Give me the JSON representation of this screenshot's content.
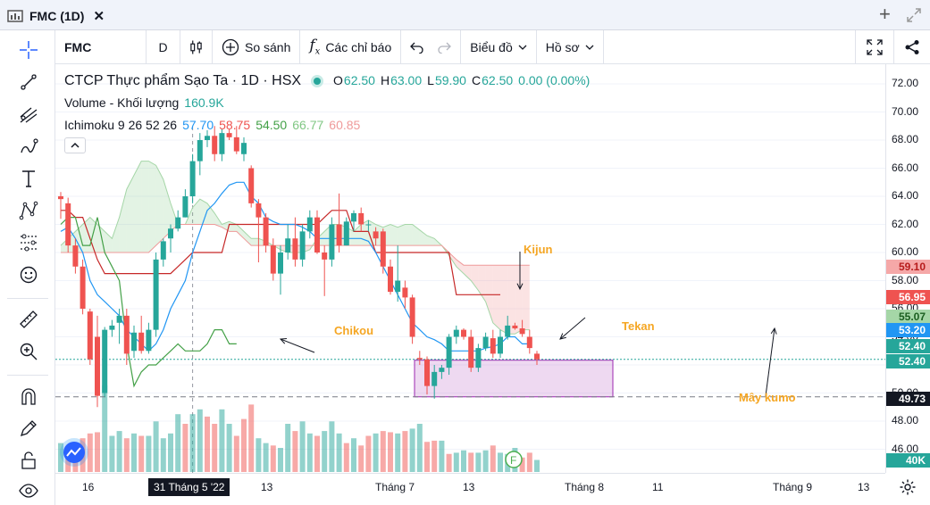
{
  "tab": {
    "title": "FMC (1D)"
  },
  "toolbar": {
    "symbol": "FMC",
    "interval": "D",
    "compare": "So sánh",
    "indicators": "Các chỉ báo",
    "chart_type": "Biểu đồ",
    "profile": "Hồ sơ"
  },
  "legend": {
    "name": "CTCP Thực phẩm Sạo Ta · 1D · HSX",
    "o_key": "O",
    "o": "62.50",
    "h_key": "H",
    "h": "63.00",
    "l_key": "L",
    "l": "59.90",
    "c_key": "C",
    "c": "62.50",
    "change": "0.00 (0.00%)",
    "volume_label": "Volume - Khối lượng",
    "volume_value": "160.9K",
    "ichimoku_label": "Ichimoku 9 26 52 26",
    "ichi_values": [
      "57.70",
      "58.75",
      "54.50",
      "66.77",
      "60.85"
    ],
    "ichi_colors": [
      "#2196f3",
      "#ef5350",
      "#43a047",
      "#81c784",
      "#ef9a9a"
    ]
  },
  "price_axis": {
    "ticks": [
      "72.00",
      "70.00",
      "68.00",
      "66.00",
      "64.00",
      "62.00",
      "60.00",
      "58.00",
      "56.00",
      "54.00",
      "50.00",
      "48.00",
      "46.00"
    ],
    "labels": [
      {
        "text": "59.10",
        "color": "#f5a8a8",
        "text_color": "#b71c1c"
      },
      {
        "text": "56.95",
        "color": "#ef5350",
        "text_color": "#ffffff"
      },
      {
        "text": "55.07",
        "color": "#a5d6a7",
        "text_color": "#1b5e20"
      },
      {
        "text": "53.20",
        "color": "#2196f3",
        "text_color": "#ffffff"
      },
      {
        "text": "52.40",
        "color": "#26a69a",
        "text_color": "#ffffff"
      },
      {
        "text": "52.40",
        "color": "#26a69a",
        "text_color": "#ffffff"
      },
      {
        "text": "49.73",
        "color": "#131722",
        "text_color": "#ffffff"
      },
      {
        "text": "40K",
        "color": "#26a69a",
        "text_color": "#ffffff"
      }
    ]
  },
  "time_axis": {
    "labels": [
      "16",
      "13",
      "Tháng 7",
      "13",
      "Tháng 8",
      "11",
      "Tháng 9",
      "13"
    ],
    "highlight": "31 Tháng 5 '22"
  },
  "annotations": {
    "chikou": "Chikou",
    "kijun": "Kijun",
    "tekan": "Tekan",
    "kumo": "Mây kumo"
  },
  "chart_data": {
    "type": "candlestick",
    "y_range": [
      45.5,
      73
    ],
    "candles": [
      {
        "o": 64.0,
        "h": 64.3,
        "l": 62.4,
        "c": 63.8
      },
      {
        "o": 63.5,
        "h": 63.9,
        "l": 60.0,
        "c": 60.5
      },
      {
        "o": 60.5,
        "h": 61.0,
        "l": 58.5,
        "c": 59.0
      },
      {
        "o": 59.0,
        "h": 59.5,
        "l": 55.6,
        "c": 56.0
      },
      {
        "o": 55.8,
        "h": 56.0,
        "l": 52.0,
        "c": 52.4
      },
      {
        "o": 54.0,
        "h": 55.5,
        "l": 49.0,
        "c": 49.8
      },
      {
        "o": 50.0,
        "h": 54.7,
        "l": 49.7,
        "c": 54.5
      },
      {
        "o": 54.5,
        "h": 55.2,
        "l": 54.0,
        "c": 54.8
      },
      {
        "o": 55.0,
        "h": 56.0,
        "l": 53.5,
        "c": 55.5
      },
      {
        "o": 55.5,
        "h": 56.0,
        "l": 52.0,
        "c": 52.8
      },
      {
        "o": 53.0,
        "h": 54.8,
        "l": 52.5,
        "c": 54.3
      },
      {
        "o": 54.3,
        "h": 55.5,
        "l": 52.8,
        "c": 53.0
      },
      {
        "o": 53.0,
        "h": 55.0,
        "l": 52.8,
        "c": 54.5
      },
      {
        "o": 54.5,
        "h": 60.0,
        "l": 54.0,
        "c": 59.5
      },
      {
        "o": 59.5,
        "h": 61.0,
        "l": 59.0,
        "c": 60.8
      },
      {
        "o": 61.0,
        "h": 62.0,
        "l": 60.0,
        "c": 61.7
      },
      {
        "o": 61.7,
        "h": 63.0,
        "l": 61.5,
        "c": 62.5
      },
      {
        "o": 62.5,
        "h": 64.5,
        "l": 62.5,
        "c": 64.0
      },
      {
        "o": 64.0,
        "h": 67.0,
        "l": 63.5,
        "c": 66.5
      },
      {
        "o": 66.5,
        "h": 68.5,
        "l": 65.5,
        "c": 68.0
      },
      {
        "o": 68.0,
        "h": 68.7,
        "l": 67.5,
        "c": 68.3
      },
      {
        "o": 68.3,
        "h": 69.0,
        "l": 66.5,
        "c": 67.0
      },
      {
        "o": 67.0,
        "h": 68.8,
        "l": 66.5,
        "c": 68.5
      },
      {
        "o": 68.5,
        "h": 68.8,
        "l": 68.0,
        "c": 68.2
      },
      {
        "o": 68.2,
        "h": 69.0,
        "l": 67.0,
        "c": 67.2
      },
      {
        "o": 67.0,
        "h": 68.2,
        "l": 66.5,
        "c": 67.8
      },
      {
        "o": 66.0,
        "h": 66.2,
        "l": 63.2,
        "c": 63.5
      },
      {
        "o": 63.5,
        "h": 63.8,
        "l": 59.3,
        "c": 62.5
      },
      {
        "o": 62.5,
        "h": 62.8,
        "l": 60.0,
        "c": 60.5
      },
      {
        "o": 60.5,
        "h": 61.0,
        "l": 58.0,
        "c": 58.5
      },
      {
        "o": 58.5,
        "h": 60.5,
        "l": 57.0,
        "c": 60.0
      },
      {
        "o": 60.0,
        "h": 62.0,
        "l": 59.5,
        "c": 61.0
      },
      {
        "o": 61.0,
        "h": 62.5,
        "l": 59.0,
        "c": 59.5
      },
      {
        "o": 59.5,
        "h": 62.0,
        "l": 59.0,
        "c": 61.5
      },
      {
        "o": 61.5,
        "h": 63.0,
        "l": 61.0,
        "c": 62.5
      },
      {
        "o": 62.5,
        "h": 63.0,
        "l": 59.9,
        "c": 60.0
      },
      {
        "o": 60.0,
        "h": 60.5,
        "l": 56.9,
        "c": 59.5
      },
      {
        "o": 59.5,
        "h": 62.5,
        "l": 59.0,
        "c": 62.0
      },
      {
        "o": 62.0,
        "h": 64.2,
        "l": 60.0,
        "c": 60.5
      },
      {
        "o": 60.5,
        "h": 62.5,
        "l": 60.5,
        "c": 62.2
      },
      {
        "o": 62.2,
        "h": 63.0,
        "l": 61.5,
        "c": 62.8
      },
      {
        "o": 62.8,
        "h": 63.2,
        "l": 61.5,
        "c": 62.0
      },
      {
        "o": 62.0,
        "h": 62.3,
        "l": 61.5,
        "c": 62.0
      },
      {
        "o": 61.5,
        "h": 61.8,
        "l": 60.5,
        "c": 61.0
      },
      {
        "o": 61.5,
        "h": 61.7,
        "l": 58.5,
        "c": 59.0
      },
      {
        "o": 59.0,
        "h": 59.5,
        "l": 57.0,
        "c": 57.2
      },
      {
        "o": 57.2,
        "h": 60.5,
        "l": 56.5,
        "c": 58.0
      },
      {
        "o": 57.5,
        "h": 58.0,
        "l": 56.0,
        "c": 56.8
      },
      {
        "o": 56.8,
        "h": 57.0,
        "l": 53.5,
        "c": 54.0
      },
      {
        "o": 52.5,
        "h": 53.0,
        "l": 52.0,
        "c": 52.4
      },
      {
        "o": 52.4,
        "h": 52.6,
        "l": 49.9,
        "c": 50.5
      },
      {
        "o": 50.5,
        "h": 52.0,
        "l": 49.6,
        "c": 51.5
      },
      {
        "o": 51.5,
        "h": 52.0,
        "l": 51.0,
        "c": 51.8
      },
      {
        "o": 51.8,
        "h": 54.2,
        "l": 51.3,
        "c": 54.0
      },
      {
        "o": 54.0,
        "h": 54.8,
        "l": 53.5,
        "c": 54.5
      },
      {
        "o": 54.5,
        "h": 54.6,
        "l": 53.8,
        "c": 54.0
      },
      {
        "o": 54.0,
        "h": 54.5,
        "l": 51.5,
        "c": 51.8
      },
      {
        "o": 51.8,
        "h": 53.5,
        "l": 51.5,
        "c": 53.2
      },
      {
        "o": 53.2,
        "h": 54.3,
        "l": 53.0,
        "c": 54.0
      },
      {
        "o": 53.9,
        "h": 54.5,
        "l": 52.5,
        "c": 52.8
      },
      {
        "o": 52.8,
        "h": 54.5,
        "l": 52.5,
        "c": 54.0
      },
      {
        "o": 54.0,
        "h": 55.5,
        "l": 53.8,
        "c": 54.8
      },
      {
        "o": 54.8,
        "h": 55.0,
        "l": 54.5,
        "c": 54.6
      },
      {
        "o": 54.6,
        "h": 55.2,
        "l": 54.0,
        "c": 54.2
      },
      {
        "o": 54.0,
        "h": 54.5,
        "l": 52.8,
        "c": 53.2
      },
      {
        "o": 52.8,
        "h": 53.0,
        "l": 52.0,
        "c": 52.4
      }
    ],
    "volume": [
      {
        "v": 120,
        "up": true
      },
      {
        "v": 85,
        "up": false
      },
      {
        "v": 90,
        "up": false
      },
      {
        "v": 140,
        "up": false
      },
      {
        "v": 160,
        "up": false
      },
      {
        "v": 165,
        "up": false
      },
      {
        "v": 360,
        "up": true
      },
      {
        "v": 150,
        "up": true
      },
      {
        "v": 170,
        "up": true
      },
      {
        "v": 140,
        "up": false
      },
      {
        "v": 160,
        "up": true
      },
      {
        "v": 150,
        "up": false
      },
      {
        "v": 150,
        "up": true
      },
      {
        "v": 210,
        "up": true
      },
      {
        "v": 140,
        "up": true
      },
      {
        "v": 160,
        "up": true
      },
      {
        "v": 240,
        "up": true
      },
      {
        "v": 200,
        "up": false
      },
      {
        "v": 240,
        "up": true
      },
      {
        "v": 260,
        "up": true
      },
      {
        "v": 230,
        "up": false
      },
      {
        "v": 200,
        "up": false
      },
      {
        "v": 260,
        "up": true
      },
      {
        "v": 200,
        "up": true
      },
      {
        "v": 150,
        "up": false
      },
      {
        "v": 220,
        "up": false
      },
      {
        "v": 280,
        "up": false
      },
      {
        "v": 140,
        "up": true
      },
      {
        "v": 120,
        "up": true
      },
      {
        "v": 110,
        "up": false
      },
      {
        "v": 100,
        "up": true
      },
      {
        "v": 200,
        "up": true
      },
      {
        "v": 170,
        "up": false
      },
      {
        "v": 210,
        "up": true
      },
      {
        "v": 160,
        "up": true
      },
      {
        "v": 150,
        "up": false
      },
      {
        "v": 170,
        "up": true
      },
      {
        "v": 210,
        "up": true
      },
      {
        "v": 160,
        "up": true
      },
      {
        "v": 120,
        "up": false
      },
      {
        "v": 140,
        "up": true
      },
      {
        "v": 110,
        "up": false
      },
      {
        "v": 150,
        "up": false
      },
      {
        "v": 160,
        "up": true
      },
      {
        "v": 170,
        "up": false
      },
      {
        "v": 165,
        "up": false
      },
      {
        "v": 160,
        "up": true
      },
      {
        "v": 170,
        "up": false
      },
      {
        "v": 180,
        "up": true
      },
      {
        "v": 200,
        "up": true
      },
      {
        "v": 125,
        "up": false
      },
      {
        "v": 130,
        "up": false
      },
      {
        "v": 130,
        "up": true
      },
      {
        "v": 75,
        "up": false
      },
      {
        "v": 80,
        "up": true
      },
      {
        "v": 90,
        "up": true
      },
      {
        "v": 80,
        "up": false
      },
      {
        "v": 80,
        "up": true
      },
      {
        "v": 90,
        "up": true
      },
      {
        "v": 110,
        "up": false
      },
      {
        "v": 80,
        "up": true
      },
      {
        "v": 75,
        "up": true
      },
      {
        "v": 100,
        "up": true
      },
      {
        "v": 60,
        "up": false
      },
      {
        "v": 80,
        "up": false
      },
      {
        "v": 50,
        "up": true
      }
    ],
    "tenkan": [
      61.5,
      61.8,
      61.0,
      60.0,
      58.0,
      57.0,
      56.5,
      56.0,
      55.5,
      54.5,
      54.0,
      53.5,
      53.0,
      53.5,
      54.5,
      56.0,
      57.0,
      58.0,
      60.0,
      61.5,
      63.0,
      63.5,
      64.2,
      64.8,
      65.0,
      65.0,
      64.0,
      63.5,
      62.5,
      62.2,
      62.0,
      62.0,
      62.0,
      61.8,
      61.5,
      61.0,
      61.0,
      61.0,
      61.0,
      61.0,
      61.0,
      61.0,
      60.8,
      60.0,
      59.0,
      58.0,
      57.0,
      56.0,
      55.0,
      54.5,
      54.0,
      53.8,
      53.5,
      53.0,
      53.0,
      53.0,
      53.0,
      53.0,
      53.2,
      53.3,
      53.5,
      54.0,
      54.0,
      53.5,
      53.5
    ],
    "kijun": [
      63.0,
      63.0,
      62.5,
      62.5,
      61.0,
      59.5,
      58.5,
      58.5,
      58.5,
      58.5,
      58.5,
      58.5,
      58.5,
      58.5,
      58.5,
      58.5,
      59.0,
      59.5,
      60.0,
      60.0,
      60.0,
      60.0,
      60.0,
      62.0,
      62.0,
      62.0,
      62.0,
      62.0,
      62.0,
      62.0,
      62.0,
      62.0,
      62.0,
      62.0,
      62.0,
      62.0,
      62.5,
      63.0,
      63.0,
      63.0,
      61.5,
      61.5,
      61.5,
      60.0,
      60.0,
      60.0,
      60.0,
      60.0,
      60.0,
      60.0,
      60.0,
      60.0,
      60.0,
      60.0,
      57.0,
      57.0,
      57.0,
      57.0,
      57.0,
      57.0,
      57.0
    ],
    "chikou": [
      62.0,
      62.5,
      62.5,
      60.5,
      60.5,
      62.5,
      60.0,
      59.0,
      58.0,
      53.5,
      50.5,
      51.5,
      52.0,
      52.0,
      52.5,
      53.0,
      53.5,
      53.0,
      53.0,
      53.0,
      53.5,
      54.5,
      54.5,
      53.5,
      53.5
    ],
    "span_a": [
      60.5,
      61.0,
      61.5,
      62.0,
      62.5,
      62.0,
      61.5,
      61.0,
      62.5,
      64.5,
      65.5,
      66.5,
      66.5,
      66.2,
      65.2,
      63.5,
      62.0,
      62.0,
      63.2,
      63.8,
      63.5,
      62.8,
      62.0,
      62.2,
      62.0,
      61.5,
      61.0,
      61.0,
      60.8,
      60.5,
      60.2,
      60.0,
      60.0,
      60.0,
      60.2,
      61.0,
      61.5,
      62.0,
      62.0,
      61.8,
      61.5,
      62.0,
      62.3,
      62.0,
      61.8,
      62.0,
      61.8,
      62.0,
      62.0,
      61.6,
      61.2,
      61.0,
      60.5,
      59.8,
      59.0,
      58.5,
      58.0,
      57.3,
      56.5,
      55.0,
      54.5,
      54.2,
      54.2,
      54.5,
      54.5
    ],
    "span_b": [
      60.0,
      60.0,
      60.0,
      60.0,
      60.0,
      60.0,
      60.0,
      60.0,
      60.0,
      60.0,
      60.0,
      60.0,
      60.0,
      60.5,
      61.0,
      61.5,
      62.0,
      62.0,
      62.0,
      62.0,
      62.0,
      62.0,
      61.8,
      61.5,
      61.5,
      61.0,
      60.5,
      60.5,
      60.5,
      60.5,
      60.5,
      60.5,
      60.5,
      60.5,
      60.5,
      60.5,
      60.5,
      60.5,
      60.5,
      60.5,
      60.5,
      60.5,
      60.5,
      60.5,
      60.5,
      60.5,
      60.5,
      60.5,
      60.5,
      60.5,
      60.5,
      60.5,
      60.5,
      60.0,
      59.5,
      59.1,
      59.1,
      59.1,
      59.1,
      59.1,
      59.1,
      59.1,
      59.1,
      59.1,
      59.1
    ],
    "support_level": 49.73,
    "last_price": 52.4
  }
}
